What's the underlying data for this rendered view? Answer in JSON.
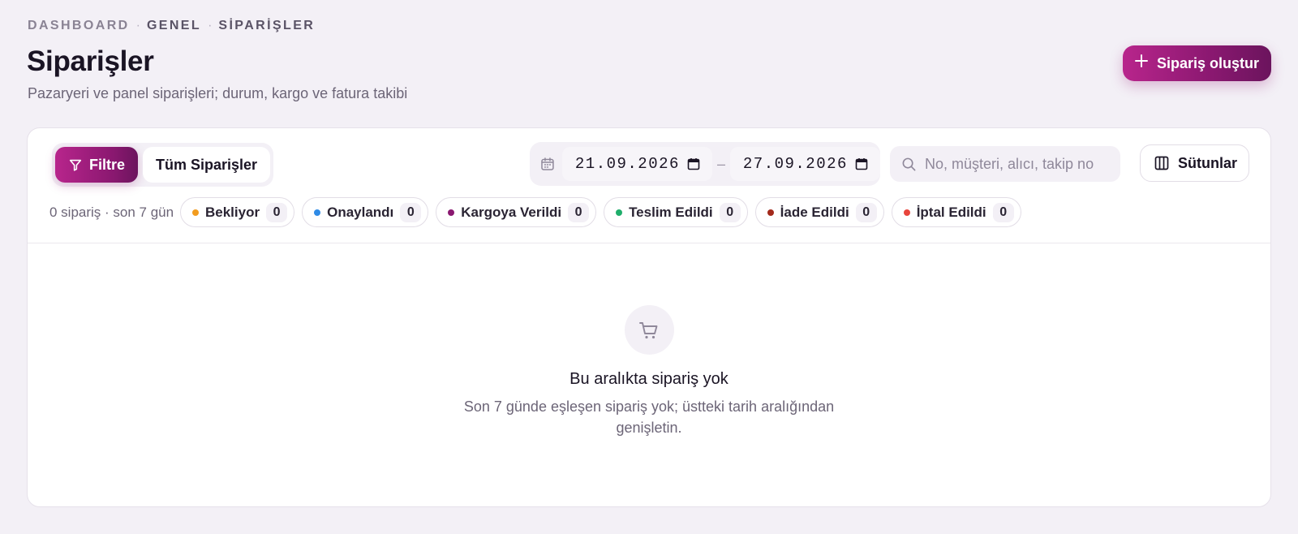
{
  "breadcrumb": {
    "items": [
      "DASHBOARD",
      "GENEL",
      "SİPARİŞLER"
    ],
    "separator": "·"
  },
  "header": {
    "title": "Siparişler",
    "subtitle": "Pazaryeri ve panel siparişleri; durum, kargo ve fatura takibi",
    "create_label": "Sipariş oluştur",
    "create_icon": "plus-icon"
  },
  "toolbar": {
    "filter_label": "Filtre",
    "filter_icon": "filter-icon",
    "all_orders_label": "Tüm Siparişler",
    "date_start": "21.09.2026",
    "date_end": "27.09.2026",
    "date_separator": "–",
    "search_placeholder": "No, müşteri, alıcı, takip no",
    "columns_label": "Sütunlar"
  },
  "summary": {
    "text": "0 sipariş · son 7 gün"
  },
  "status_chips": [
    {
      "label": "Bekliyor",
      "count": "0",
      "color": "#f29c1f"
    },
    {
      "label": "Onaylandı",
      "count": "0",
      "color": "#2f8be6"
    },
    {
      "label": "Kargoya Verildi",
      "count": "0",
      "color": "#8a1870"
    },
    {
      "label": "Teslim Edildi",
      "count": "0",
      "color": "#1fae6b"
    },
    {
      "label": "İade Edildi",
      "count": "0",
      "color": "#a3291b"
    },
    {
      "label": "İptal Edildi",
      "count": "0",
      "color": "#e8453c"
    }
  ],
  "empty_state": {
    "icon": "cart-icon",
    "title": "Bu aralıkta sipariş yok",
    "description": "Son 7 günde eşleşen sipariş yok; üstteki tarih aralığından genişletin."
  },
  "colors": {
    "accent": "#8a1870",
    "accent_light": "#b8258c",
    "background": "#f3f0f6"
  }
}
